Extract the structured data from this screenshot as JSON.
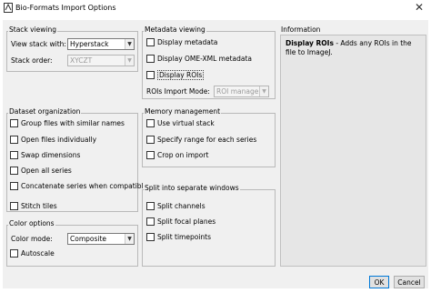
{
  "window": {
    "title": "Bio-Formats Import Options",
    "close_glyph": "✕"
  },
  "stack_viewing": {
    "title": "Stack viewing",
    "view_stack_label": "View stack with:",
    "view_stack_value": "Hyperstack",
    "stack_order_label": "Stack order:",
    "stack_order_value": "XYCZT"
  },
  "metadata_viewing": {
    "title": "Metadata viewing",
    "display_metadata": "Display metadata",
    "display_ome_xml": "Display OME-XML metadata",
    "display_rois": "Display ROIs",
    "rois_import_mode_label": "ROIs Import Mode:",
    "rois_import_mode_value": "ROI manager"
  },
  "information": {
    "title": "Information",
    "heading": "Display ROIs",
    "body": " - Adds any ROIs in the file to ImageJ."
  },
  "dataset_organization": {
    "title": "Dataset organization",
    "group_files": "Group files with similar names",
    "open_individually": "Open files individually",
    "swap_dimensions": "Swap dimensions",
    "open_all_series": "Open all series",
    "concatenate": "Concatenate series when compatible",
    "stitch_tiles": "Stitch tiles"
  },
  "memory_management": {
    "title": "Memory management",
    "use_virtual_stack": "Use virtual stack",
    "specify_range": "Specify range for each series",
    "crop_on_import": "Crop on import"
  },
  "split_windows": {
    "title": "Split into separate windows",
    "split_channels": "Split channels",
    "split_focal_planes": "Split focal planes",
    "split_timepoints": "Split timepoints"
  },
  "color_options": {
    "title": "Color options",
    "color_mode_label": "Color mode:",
    "color_mode_value": "Composite",
    "autoscale": "Autoscale"
  },
  "buttons": {
    "ok": "OK",
    "cancel": "Cancel"
  },
  "icons": {
    "app": "imagej-app-icon",
    "dropdown": "chevron-down-icon",
    "close": "close-icon"
  }
}
